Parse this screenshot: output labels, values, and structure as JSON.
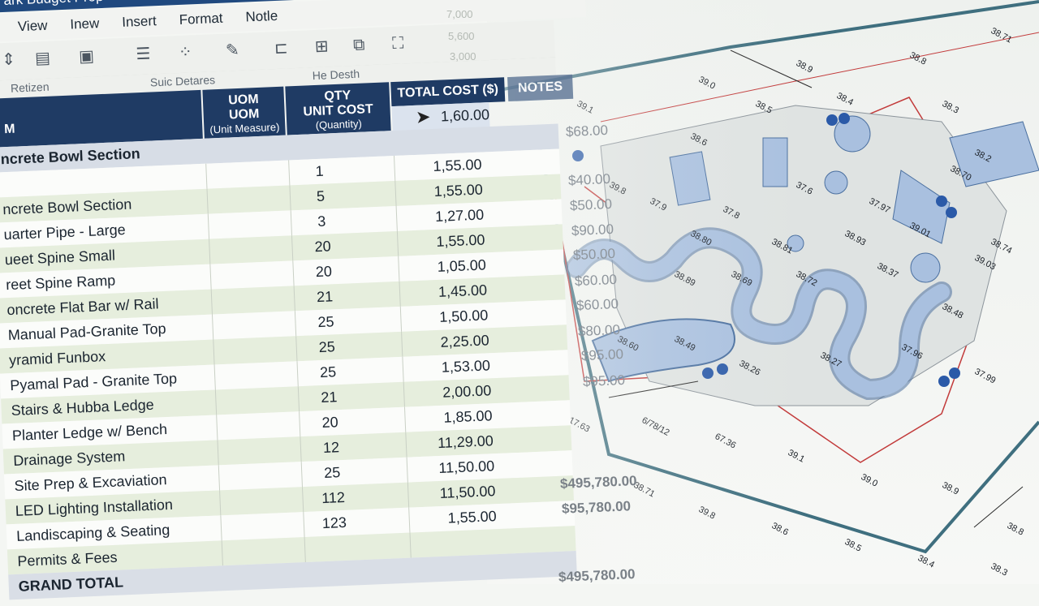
{
  "window": {
    "title": "ark Budget Prop"
  },
  "menu": [
    "View",
    "Inew",
    "Insert",
    "Format",
    "Notle"
  ],
  "toolbar": {
    "group_labels": [
      "Retizen",
      "Suic Detares",
      "He Desth"
    ]
  },
  "table": {
    "headers": {
      "item": "M",
      "uom": "UOM",
      "uom_sub1": "UOM",
      "uom_sub2": "(Unit Measure)",
      "qty": "QTY",
      "unit_cost": "UNIT COST",
      "qty_sub": "(Quantity)",
      "total_cost": "TOTAL COST ($)",
      "notes": "NOTES"
    },
    "section_label": "ncrete Bowl Section",
    "header_cost_value": "1,60.00",
    "rows": [
      {
        "item": "",
        "qty": "1",
        "cost": "1,55.00"
      },
      {
        "item": "ncrete Bowl Section",
        "qty": "5",
        "cost": "1,55.00"
      },
      {
        "item": "uarter Pipe - Large",
        "qty": "3",
        "cost": "1,27.00"
      },
      {
        "item": "ueet Spine Small",
        "qty": "20",
        "cost": "1,55.00"
      },
      {
        "item": "reet Spine Ramp",
        "qty": "20",
        "cost": "1,05.00"
      },
      {
        "item": "oncrete Flat Bar w/ Rail",
        "qty": "21",
        "cost": "1,45.00"
      },
      {
        "item": "Manual Pad-Granite Top",
        "qty": "25",
        "cost": "1,50.00"
      },
      {
        "item": "yramid Funbox",
        "qty": "25",
        "cost": "2,25.00"
      },
      {
        "item": "Pyamal Pad - Granite Top",
        "qty": "25",
        "cost": "1,53.00"
      },
      {
        "item": "Stairs & Hubba Ledge",
        "qty": "21",
        "cost": "2,00.00"
      },
      {
        "item": "Planter Ledge w/ Bench",
        "qty": "20",
        "cost": "1,85.00"
      },
      {
        "item": "Drainage System",
        "qty": "12",
        "cost": "11,29.00"
      },
      {
        "item": "Site Prep & Excaviation",
        "qty": "25",
        "cost": "11,50.00"
      },
      {
        "item": "LED Lighting Installation",
        "qty": "112",
        "cost": "11,50.00"
      },
      {
        "item": "Landiscaping & Seating",
        "qty": "123",
        "cost": "1,55.00"
      },
      {
        "item": "Permits & Fees",
        "qty": "",
        "cost": ""
      }
    ],
    "grand_total_label": "GRAND TOTAL",
    "notes_values": [
      "$68.00",
      "$40.00",
      "$50.00",
      "$90.00",
      "$50.00",
      "$60.00",
      "$60.00",
      "$80.00",
      "$95.00",
      "$95.00",
      "$495,780.00",
      "$95,780.00",
      "$495,780.00"
    ],
    "faded_top_values": [
      "7,000",
      "5,600",
      "3,000"
    ]
  },
  "site_plan": {
    "elevations": [
      "39.1",
      "39.0",
      "38.9",
      "38.8",
      "38.71",
      "39.8",
      "38.6",
      "38.5",
      "38.4",
      "38.3",
      "38.2",
      "37.9",
      "37.8",
      "37.6",
      "37.97",
      "38.70",
      "38.74",
      "38.80",
      "38.81",
      "38.93",
      "39.01",
      "39.03",
      "38.89",
      "38.69",
      "38.72",
      "38.37",
      "38.48",
      "38.60",
      "38.49",
      "38.26",
      "38.27",
      "37.96",
      "37.99",
      "17.63",
      "6/78/12",
      "67.36"
    ],
    "colors": {
      "boundary": "#3f6f7f",
      "redline": "#c23a3a",
      "path_fill": "#a9c0df",
      "path_stroke": "#4a6f9f",
      "marker": "#2b5aa8"
    }
  }
}
